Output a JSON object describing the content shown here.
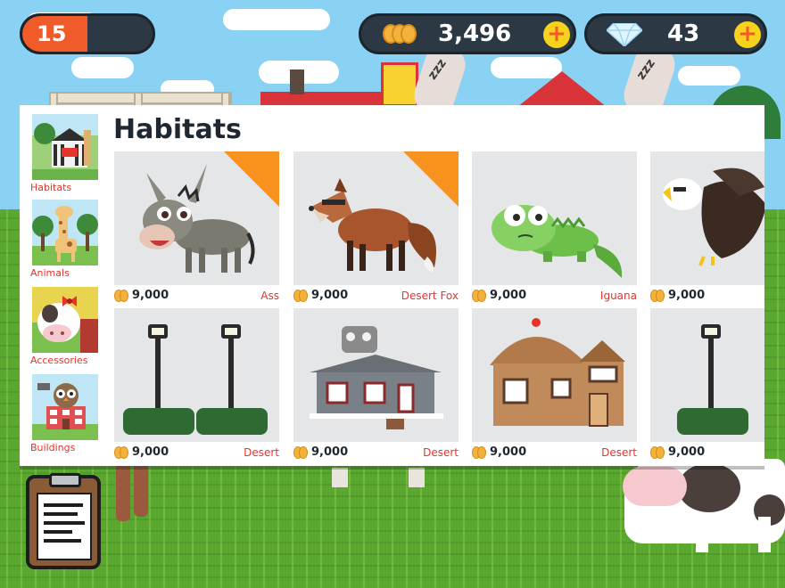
{
  "hud": {
    "level": "15",
    "level_progress": 0.5,
    "coins": "3,496",
    "gems": "43",
    "add_coins_icon": "plus-icon",
    "add_gems_icon": "plus-icon",
    "coin_icon": "coin-stack-icon",
    "gem_icon": "diamond-icon"
  },
  "shop": {
    "title": "Habitats",
    "categories": [
      {
        "label": "Habitats",
        "icon": "zebra-habitat-thumbnail"
      },
      {
        "label": "Animals",
        "icon": "giraffe-thumbnail"
      },
      {
        "label": "Accessories",
        "icon": "cow-bow-thumbnail"
      },
      {
        "label": "Buildings",
        "icon": "owl-building-thumbnail"
      }
    ],
    "items": [
      {
        "price": "9,000",
        "name": "Ass",
        "art": "donkey",
        "new_badge": true
      },
      {
        "price": "9,000",
        "name": "Desert Fox",
        "art": "fox",
        "new_badge": true
      },
      {
        "price": "9,000",
        "name": "Iguana",
        "art": "iguana",
        "new_badge": false
      },
      {
        "price": "9,000",
        "name": "",
        "art": "eagle",
        "new_badge": false
      },
      {
        "price": "9,000",
        "name": "Desert",
        "art": "lamp-posts-hedges",
        "new_badge": false
      },
      {
        "price": "9,000",
        "name": "Desert",
        "art": "grey-house",
        "new_badge": false
      },
      {
        "price": "9,000",
        "name": "Desert",
        "art": "wooden-barn",
        "new_badge": false
      },
      {
        "price": "9,000",
        "name": "",
        "art": "lamp-post-hedge",
        "new_badge": false
      }
    ]
  },
  "colors": {
    "accent_red": "#e5342c",
    "ribbon_orange": "#f7931e",
    "hud_dark": "#2c3844",
    "level_orange": "#f15a29",
    "plus_yellow": "#f6d21d"
  },
  "clipboard_icon": "clipboard-icon"
}
